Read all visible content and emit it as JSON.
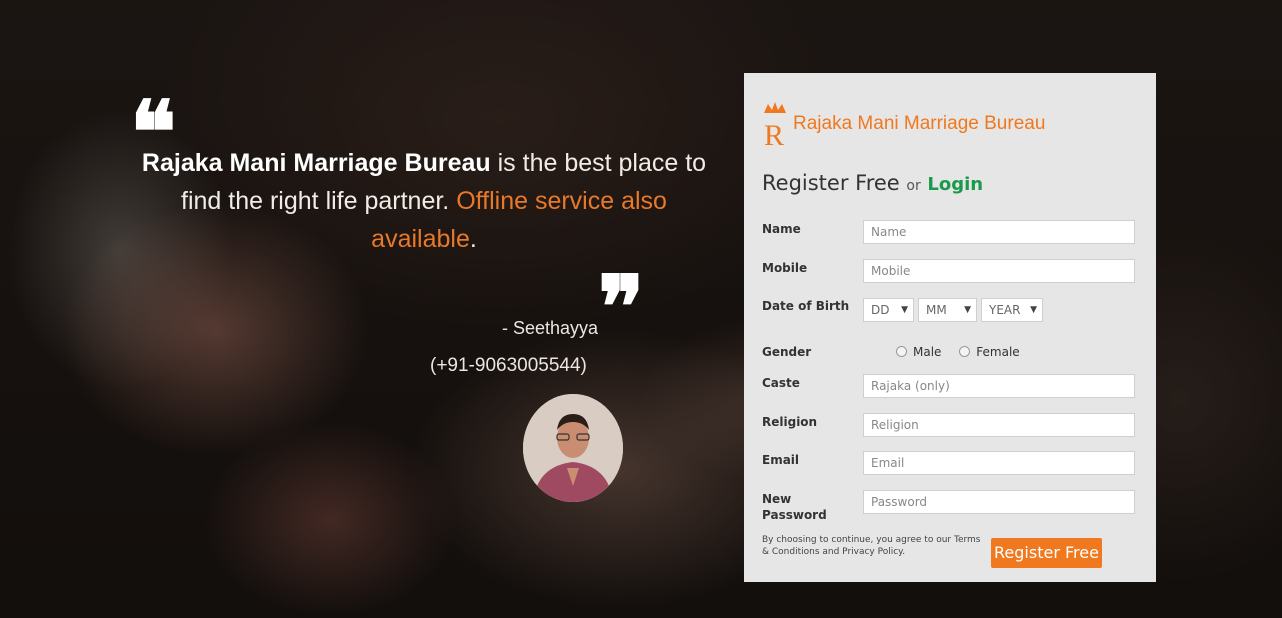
{
  "hero": {
    "quote_brand": "Rajaka Mani Marriage Bureau",
    "quote_middle": " is the best place to find the right life partner. ",
    "quote_accent": "Offline service also available",
    "quote_end": ".",
    "author": "- Seethayya",
    "phone": "(+91-9063005544)"
  },
  "panel": {
    "brand_name": "Rajaka Mani Marriage Bureau",
    "logo_letter": "R",
    "title": "Register Free",
    "or_text": "or",
    "login_label": "Login",
    "fields": {
      "name_label": "Name",
      "name_placeholder": "Name",
      "mobile_label": "Mobile",
      "mobile_placeholder": "Mobile",
      "dob_label": "Date of Birth",
      "dob_day": "DD",
      "dob_month": "MM",
      "dob_year": "YEAR",
      "gender_label": "Gender",
      "gender_male": "Male",
      "gender_female": "Female",
      "caste_label": "Caste",
      "caste_placeholder": "Rajaka (only)",
      "religion_label": "Religion",
      "religion_placeholder": "Religion",
      "email_label": "Email",
      "email_placeholder": "Email",
      "password_label": "New Password",
      "password_placeholder": "Password"
    },
    "terms_text": "By choosing to continue, you agree to our Terms & Conditions and Privacy Policy.",
    "register_button": "Register Free"
  },
  "colors": {
    "accent_orange": "#f0781f",
    "login_green": "#1a9a4a",
    "panel_bg": "#e6e6e6"
  },
  "icons": [
    "quote-open-icon",
    "quote-close-icon",
    "crown-icon",
    "dropdown-arrow-icon"
  ]
}
